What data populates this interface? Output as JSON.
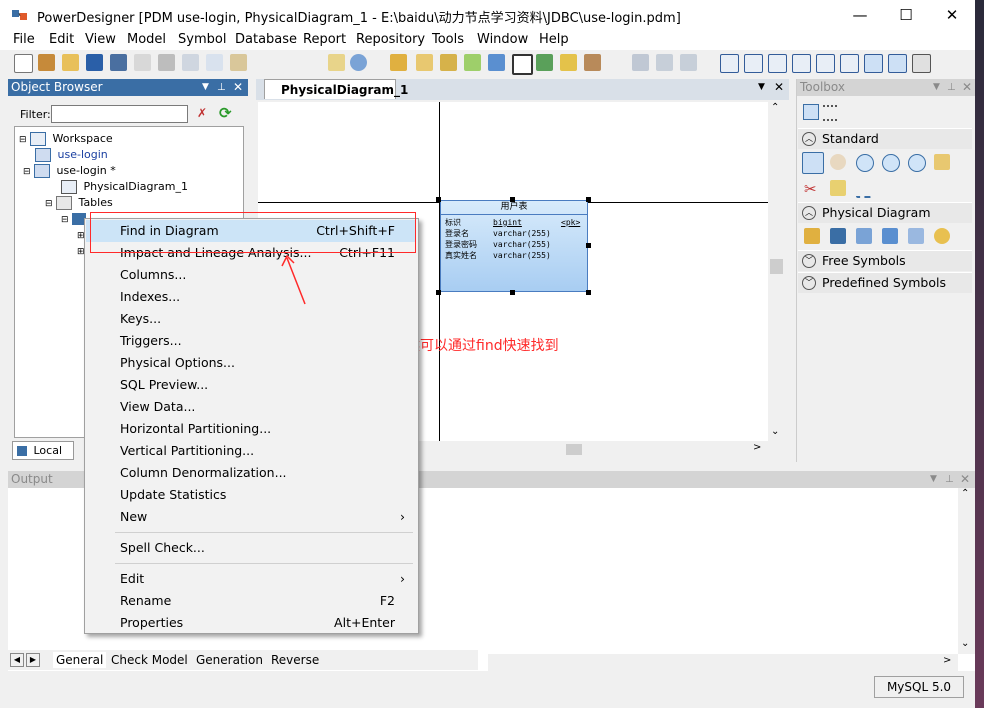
{
  "window": {
    "title": "PowerDesigner [PDM use-login, PhysicalDiagram_1 - E:\\baidu\\动力节点学习资料\\JDBC\\use-login.pdm]",
    "minimize": "—",
    "maximize": "☐",
    "close": "✕"
  },
  "menu": [
    "File",
    "Edit",
    "View",
    "Model",
    "Symbol",
    "Database",
    "Report",
    "Repository",
    "Tools",
    "Window",
    "Help"
  ],
  "object_browser": {
    "title": "Object Browser",
    "filter_label": "Filter:",
    "filter_value": "",
    "tree": [
      {
        "label": "Workspace",
        "depth": 0
      },
      {
        "label": "use-login",
        "depth": 1
      },
      {
        "label": "use-login *",
        "depth": 1
      },
      {
        "label": "PhysicalDiagram_1",
        "depth": 2
      },
      {
        "label": "Tables",
        "depth": 2
      }
    ],
    "tab_local": "Local"
  },
  "diagram": {
    "tab": "PhysicalDiagram_1",
    "table": {
      "name": "用户表",
      "columns": [
        {
          "name": "标识",
          "type": "bigint",
          "key": "<pk>"
        },
        {
          "name": "登录名",
          "type": "varchar(255)",
          "key": ""
        },
        {
          "name": "登录密码",
          "type": "varchar(255)",
          "key": ""
        },
        {
          "name": "真实姓名",
          "type": "varchar(255)",
          "key": ""
        }
      ]
    }
  },
  "annotation": "当表格太多的时候可以通过find快速找到",
  "context_menu": [
    {
      "label": "Find in Diagram",
      "shortcut": "Ctrl+Shift+F",
      "highlight": true
    },
    {
      "label": "Impact and Lineage Analysis...",
      "shortcut": "Ctrl+F11"
    },
    {
      "label": "Columns..."
    },
    {
      "label": "Indexes..."
    },
    {
      "label": "Keys..."
    },
    {
      "label": "Triggers..."
    },
    {
      "label": "Physical Options..."
    },
    {
      "label": "SQL Preview..."
    },
    {
      "label": "View Data..."
    },
    {
      "label": "Horizontal Partitioning..."
    },
    {
      "label": "Vertical Partitioning..."
    },
    {
      "label": "Column Denormalization..."
    },
    {
      "label": "Update Statistics"
    },
    {
      "label": "New",
      "submenu": true
    },
    {
      "separator": true
    },
    {
      "label": "Spell Check..."
    },
    {
      "separator": true
    },
    {
      "label": "Edit",
      "submenu": true
    },
    {
      "label": "Rename",
      "shortcut": "F2"
    },
    {
      "label": "Properties",
      "shortcut": "Alt+Enter"
    }
  ],
  "toolbox": {
    "title": "Toolbox",
    "sections": [
      {
        "label": "Standard",
        "expanded": true
      },
      {
        "label": "Physical Diagram",
        "expanded": true
      },
      {
        "label": "Free Symbols",
        "expanded": false
      },
      {
        "label": "Predefined Symbols",
        "expanded": false
      }
    ]
  },
  "output": {
    "title": "Output"
  },
  "bottom_tabs": [
    "General",
    "Check Model",
    "Generation",
    "Reverse"
  ],
  "status": {
    "dbms": "MySQL 5.0"
  },
  "colors": {
    "accent": "#3a6ea5",
    "highlight": "#cce4f7",
    "annotation": "#ff2a2a",
    "table_fill": "#bcd9f5"
  }
}
